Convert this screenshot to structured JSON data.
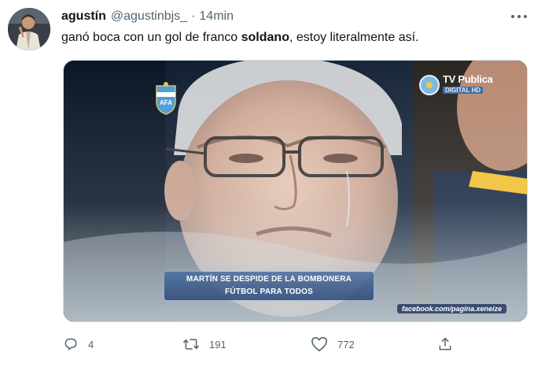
{
  "author": {
    "display_name": "agustín",
    "handle": "@agustinbjs_",
    "separator": "·",
    "time": "14min"
  },
  "tweet": {
    "text_before": "ganó boca con un gol de franco ",
    "text_bold": "soldano",
    "text_after": ", estoy literalmente así."
  },
  "media": {
    "channel_name": "TV Publica",
    "channel_sub": "DIGITAL HD",
    "caption_line1": "MARTÍN SE DESPIDE DE LA BOMBONERA",
    "caption_line2": "FÚTBOL PARA TODOS",
    "watermark": "facebook.com/pagina.xeneize",
    "badge_text": "AFA"
  },
  "actions": {
    "reply_count": "4",
    "retweet_count": "191",
    "like_count": "772"
  },
  "icons": {
    "more": "more-options-icon",
    "reply": "reply-icon",
    "retweet": "retweet-icon",
    "like": "heart-icon",
    "share": "share-icon"
  },
  "colors": {
    "secondary_text": "#536471",
    "primary_text": "#0f1419"
  }
}
